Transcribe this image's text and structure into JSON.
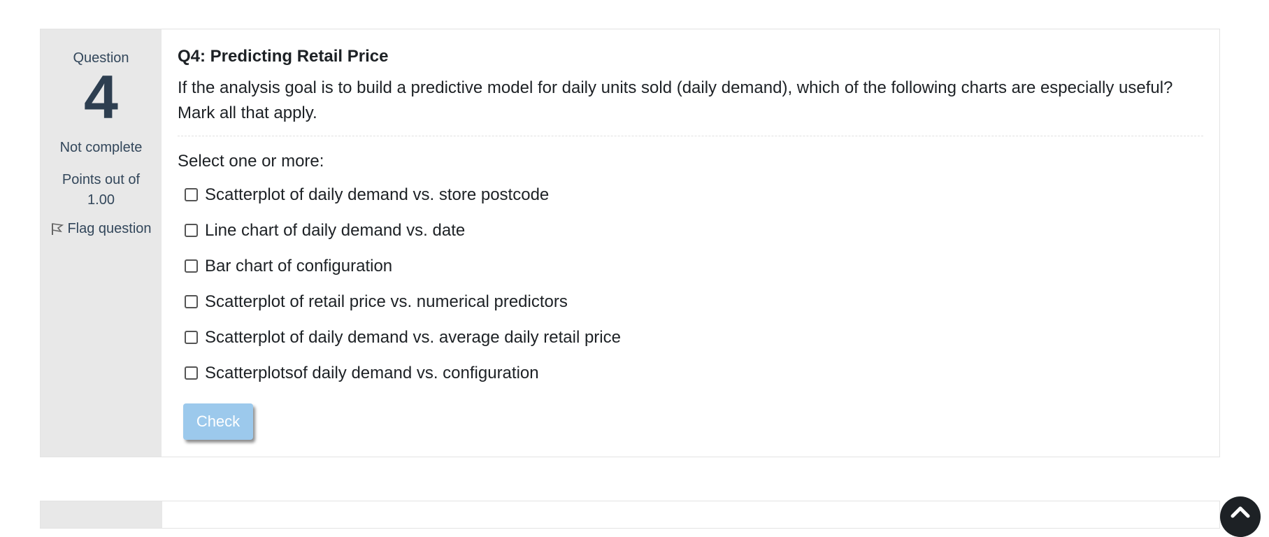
{
  "question": {
    "label": "Question",
    "number": "4",
    "state": "Not complete",
    "grade": "Points out of 1.00",
    "flag_label": "Flag question",
    "title": "Q4: Predicting Retail Price",
    "text": "If the analysis goal is to build a predictive model for daily units sold (daily demand), which of the following charts are especially useful? Mark all that apply.",
    "prompt": "Select one or more:",
    "options": [
      "Scatterplot of daily demand vs. store postcode",
      "Line chart of daily demand vs. date",
      "Bar chart of configuration",
      "Scatterplot of retail price vs. numerical predictors",
      "Scatterplot of daily demand vs. average daily retail price",
      "Scatterplotsof daily demand vs. configuration"
    ],
    "check_label": "Check"
  },
  "icons": {
    "flag": "flag-icon",
    "scroll_top": "chevron-up-icon"
  },
  "colors": {
    "info_bg": "#e8e8e8",
    "button_bg": "#9cc9ec",
    "number_color": "#2d3e50"
  }
}
